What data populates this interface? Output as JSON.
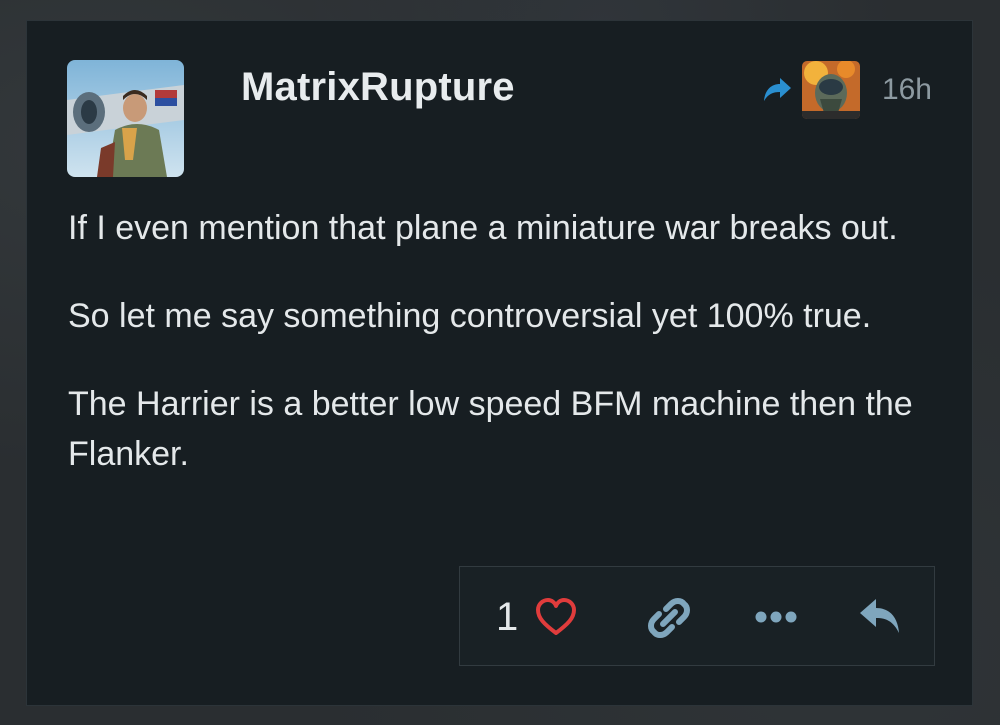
{
  "post": {
    "username": "MatrixRupture",
    "time": "16h",
    "paragraphs": [
      "If I even mention that plane a miniature war breaks out.",
      "So let me say something controversial yet 100% true.",
      "The Harrier is a better low speed BFM machine then the Flanker."
    ],
    "icons": {
      "avatar": "pilot-avatar",
      "reply_to": "reply-arrow-icon",
      "reply_to_avatar": "pilot-helmet-avatar",
      "like": "heart-icon",
      "link": "link-icon",
      "more": "more-dots-icon",
      "reply": "reply-icon"
    }
  },
  "actions": {
    "like_count": "1"
  },
  "colors": {
    "background": "#171e22",
    "text": "#e4e8ea",
    "muted": "#8d9aa1",
    "accent_blue": "#2a8fd0",
    "heart": "#e03c3c",
    "action_icons": "#7fa6bd"
  }
}
